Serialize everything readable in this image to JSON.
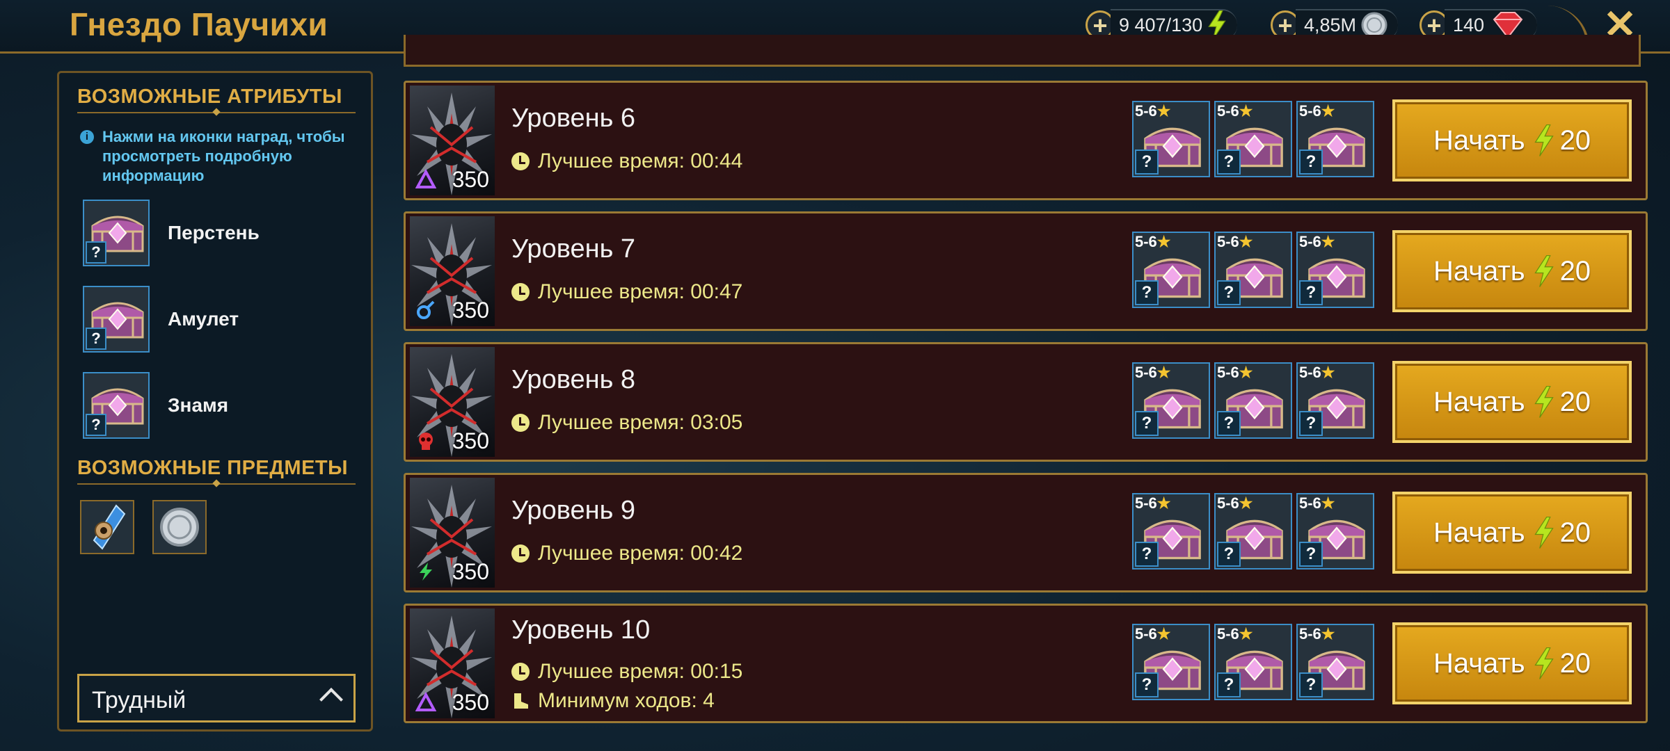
{
  "header": {
    "title": "Гнездо Паучихи",
    "resources": [
      {
        "name": "energy",
        "value": "9 407/130",
        "icon": "lightning-icon"
      },
      {
        "name": "silver",
        "value": "4,85M",
        "icon": "silver-coin-icon"
      },
      {
        "name": "gems",
        "value": "140",
        "icon": "ruby-gem-icon"
      }
    ],
    "close_label": "✕"
  },
  "sidebar": {
    "attributes_heading": "ВОЗМОЖНЫЕ АТРИБУТЫ",
    "info_text": "Нажми на иконки наград, чтобы просмотреть подробную информацию",
    "attributes": [
      {
        "label": "Перстень",
        "icon": "chest-icon"
      },
      {
        "label": "Амулет",
        "icon": "chest-icon"
      },
      {
        "label": "Знамя",
        "icon": "chest-icon"
      }
    ],
    "items_heading": "ВОЗМОЖНЫЕ ПРЕДМЕТЫ",
    "items": [
      {
        "icon": "xp-potion-icon"
      },
      {
        "icon": "silver-coin-icon"
      }
    ],
    "difficulty": "Трудный"
  },
  "levels": [
    {
      "title": "Уровень 6",
      "power": "350",
      "affinity": "magic",
      "best_time": "Лучшее время: 00:44",
      "min_turns": "",
      "reward_stars": [
        "5-6",
        "5-6",
        "5-6"
      ],
      "start_label": "Начать",
      "cost": "20"
    },
    {
      "title": "Уровень 7",
      "power": "350",
      "affinity": "spirit",
      "best_time": "Лучшее время: 00:47",
      "min_turns": "",
      "reward_stars": [
        "5-6",
        "5-6",
        "5-6"
      ],
      "start_label": "Начать",
      "cost": "20"
    },
    {
      "title": "Уровень 8",
      "power": "350",
      "affinity": "force",
      "best_time": "Лучшее время: 03:05",
      "min_turns": "",
      "reward_stars": [
        "5-6",
        "5-6",
        "5-6"
      ],
      "start_label": "Начать",
      "cost": "20"
    },
    {
      "title": "Уровень 9",
      "power": "350",
      "affinity": "void",
      "best_time": "Лучшее время: 00:42",
      "min_turns": "",
      "reward_stars": [
        "5-6",
        "5-6",
        "5-6"
      ],
      "start_label": "Начать",
      "cost": "20"
    },
    {
      "title": "Уровень 10",
      "power": "350",
      "affinity": "magic",
      "best_time": "Лучшее время: 00:15",
      "min_turns": "Минимум ходов: 4",
      "reward_stars": [
        "5-6",
        "5-6",
        "5-6"
      ],
      "start_label": "Начать",
      "cost": "20"
    }
  ],
  "colors": {
    "accent_gold": "#d9a640",
    "time_yellow": "#ede88a",
    "row_bg": "#2c1112",
    "button_orange": "#e5a91f"
  }
}
